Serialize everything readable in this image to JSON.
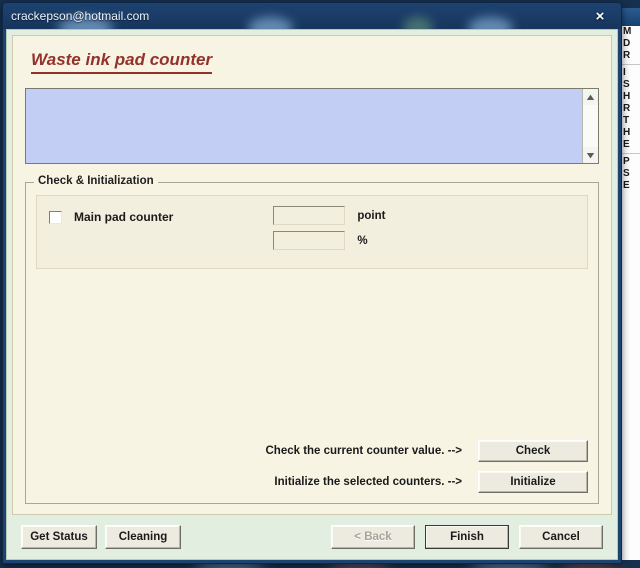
{
  "window": {
    "title": "crackepson@hotmail.com",
    "close_label": "×"
  },
  "heading": "Waste ink pad counter",
  "log": {
    "text": "",
    "scroll_up_icon": "triangle-up-icon",
    "scroll_down_icon": "triangle-down-icon"
  },
  "group": {
    "legend": "Check & Initialization",
    "counter": {
      "label": "Main pad counter",
      "checked": false,
      "point_value": "",
      "point_unit": "point",
      "percent_value": "",
      "percent_unit": "%"
    },
    "actions": [
      {
        "text": "Check the current counter value. -->",
        "button": "Check"
      },
      {
        "text": "Initialize the selected counters. -->",
        "button": "Initialize"
      }
    ]
  },
  "buttonbar": {
    "get_status": "Get Status",
    "cleaning": "Cleaning",
    "back": "< Back",
    "finish": "Finish",
    "cancel": "Cancel"
  },
  "background_window": {
    "lines": [
      "M",
      "D",
      "R",
      "I",
      "S",
      "H",
      "R",
      "T",
      "H",
      "E",
      "P",
      "S",
      "E"
    ]
  },
  "colors": {
    "accent_heading": "#93312b",
    "window_chrome": "#1d4470",
    "content_bg": "#f8f4e4",
    "frame_bg": "#e2efe0",
    "log_bg": "#c3cef5"
  }
}
